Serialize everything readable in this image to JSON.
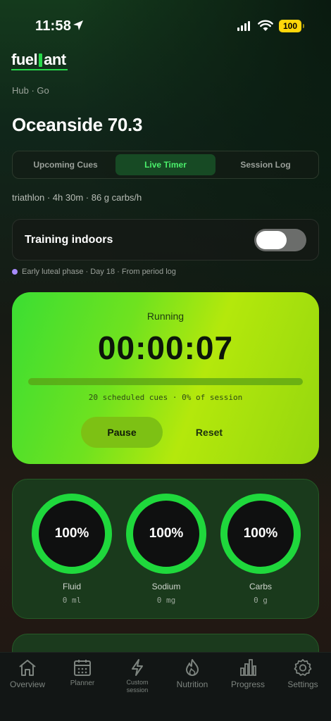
{
  "status_bar": {
    "time": "11:58",
    "battery": "100"
  },
  "logo": "fuel",
  "logo_tail": "ant",
  "breadcrumb": "Hub · Go",
  "page_title": "Oceanside 70.3",
  "tabs": [
    {
      "label": "Upcoming Cues",
      "active": false
    },
    {
      "label": "Live Timer",
      "active": true
    },
    {
      "label": "Session Log",
      "active": false
    }
  ],
  "meta": "triathlon · 4h 30m · 86 g carbs/h",
  "indoor": {
    "label": "Training indoors",
    "enabled": false
  },
  "phase": "Early luteal phase · Day 18 · From period log",
  "timer": {
    "status": "Running",
    "value": "00:00:07",
    "progress_fraction": 0,
    "subtitle": "20 scheduled cues · 0% of session",
    "pause_label": "Pause",
    "reset_label": "Reset"
  },
  "gauges": [
    {
      "percent": "100%",
      "label": "Fluid",
      "value": "0 ml"
    },
    {
      "percent": "100%",
      "label": "Sodium",
      "value": "0 mg"
    },
    {
      "percent": "100%",
      "label": "Carbs",
      "value": "0 g"
    }
  ],
  "tabbar": [
    {
      "label": "Overview",
      "icon": "home-icon"
    },
    {
      "label": "Planner",
      "icon": "calendar-icon"
    },
    {
      "label_line1": "Custom",
      "label_line2": "session",
      "icon": "bolt-icon"
    },
    {
      "label": "Nutrition",
      "icon": "flame-icon"
    },
    {
      "label": "Progress",
      "icon": "bar-chart-icon"
    },
    {
      "label": "Settings",
      "icon": "gear-icon"
    }
  ],
  "colors": {
    "accent": "#27d84a",
    "ring": "#1fd83c",
    "timer_gradient_start": "#3bde33",
    "timer_gradient_end": "#b4e80c"
  }
}
